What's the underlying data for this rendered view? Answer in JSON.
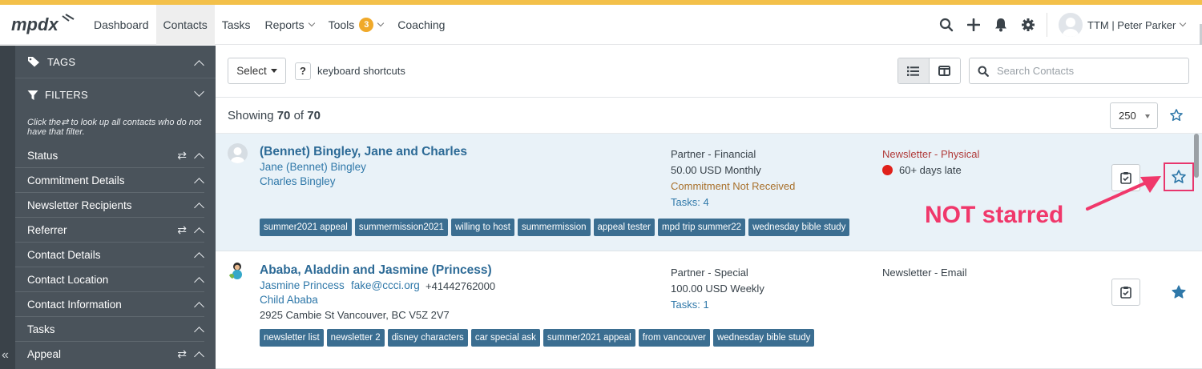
{
  "nav": {
    "logo_text": "mpdx",
    "items": [
      {
        "label": "Dashboard"
      },
      {
        "label": "Contacts",
        "active": true
      },
      {
        "label": "Tasks"
      },
      {
        "label": "Reports",
        "dropdown": true
      },
      {
        "label": "Tools",
        "badge": "3",
        "dropdown": true
      },
      {
        "label": "Coaching"
      }
    ],
    "user_label": "TTM | Peter Parker",
    "icons": [
      "search-icon",
      "plus-icon",
      "bell-icon",
      "gear-icon"
    ],
    "accent_color": "#f3c04a"
  },
  "sidebar": {
    "tags_label": "TAGS",
    "filters_label": "FILTERS",
    "note_prefix": "Click the",
    "note_suffix": " to look up all contacts who do not have that filter.",
    "filters": [
      {
        "label": "Status",
        "swap": true
      },
      {
        "label": "Commitment Details",
        "swap": false
      },
      {
        "label": "Newsletter Recipients",
        "swap": false
      },
      {
        "label": "Referrer",
        "swap": true
      },
      {
        "label": "Contact Details",
        "swap": false
      },
      {
        "label": "Contact Location",
        "swap": false
      },
      {
        "label": "Contact Information",
        "swap": false
      },
      {
        "label": "Tasks",
        "swap": false
      },
      {
        "label": "Appeal",
        "swap": true
      }
    ]
  },
  "toolbar": {
    "select_label": "Select",
    "shortcut_key": "?",
    "shortcut_label": "keyboard shortcuts",
    "search_placeholder": "Search Contacts"
  },
  "list": {
    "showing_prefix": "Showing ",
    "shown": "70",
    "of": " of ",
    "total": "70",
    "per_page": "250"
  },
  "contacts": [
    {
      "name": "(Bennet) Bingley, Jane and Charles",
      "people": [
        "Jane (Bennet) Bingley",
        "Charles Bingley"
      ],
      "status": "Partner - Financial",
      "commitment": "50.00 USD Monthly",
      "commitment_note": "Commitment Not Received",
      "tasks": "Tasks: 4",
      "newsletter": "Newsletter - Physical",
      "late": "60+ days late",
      "tags": [
        "summer2021 appeal",
        "summermission2021",
        "willing to host",
        "summermission",
        "appeal tester",
        "mpd trip summer22",
        "wednesday bible study"
      ],
      "starred": false
    },
    {
      "name": "Ababa, Aladdin and Jasmine (Princess)",
      "person": "Jasmine Princess",
      "email": "fake@ccci.org",
      "phone": "+41442762000",
      "child": "Child Ababa",
      "address": "2925 Cambie St Vancouver, BC V5Z 2V7",
      "status": "Partner - Special",
      "commitment": "100.00 USD Weekly",
      "tasks": "Tasks: 1",
      "newsletter": "Newsletter - Email",
      "tags": [
        "newsletter list",
        "newsletter 2",
        "disney characters",
        "car special ask",
        "summer2021 appeal",
        "from vancouver",
        "wednesday bible study"
      ],
      "starred": true
    }
  ],
  "annotation": {
    "text": "NOT starred",
    "color": "#f0386b"
  }
}
